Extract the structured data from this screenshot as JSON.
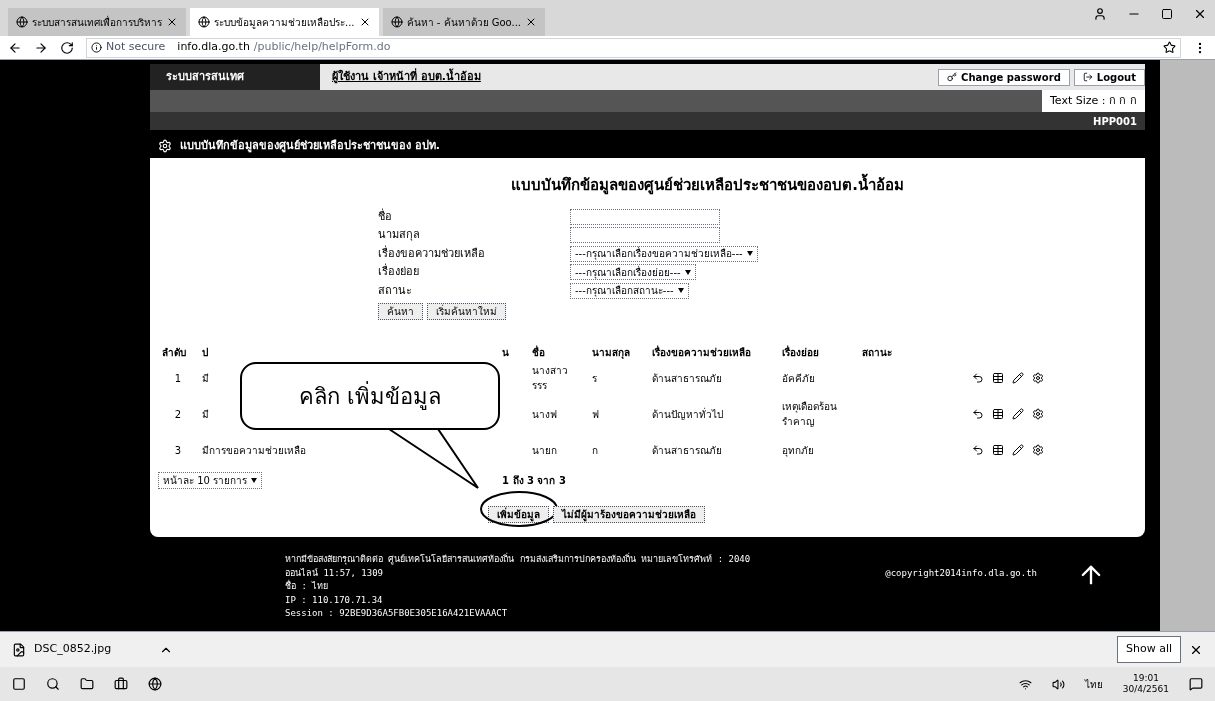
{
  "browser": {
    "tabs": [
      {
        "title": "ระบบสารสนเทศเพื่อการบริหาร",
        "selected": false
      },
      {
        "title": "ระบบข้อมูลความช่วยเหลือประ...",
        "selected": true
      },
      {
        "title": "ค้นหา - ค้นหาด้วย Goo...",
        "selected": false
      }
    ],
    "security": "Not secure",
    "url": "info.dla.go.th",
    "url_path": "/public/help/helpForm.do"
  },
  "header": {
    "app_tab": "ระบบสารสนเทศ",
    "user": "ผู้ใช้งาน เจ้าหน้าที่ อบต.น้ำอ้อม",
    "change_password": "Change password",
    "logout": "Logout",
    "text_size": "Text Size : ก ก ก",
    "code": "HPP001"
  },
  "section_title": "แบบบันทึกข้อมูลของศูนย์ช่วยเหลือประชาชนของ อปท.",
  "form": {
    "title": "แบบบันทึกข้อมูลของศูนย์ช่วยเหลือประชาชนของอบต.น้ำอ้อม",
    "fields": [
      {
        "label": "ชื่อ",
        "kind": "text"
      },
      {
        "label": "นามสกุล",
        "kind": "text"
      },
      {
        "label": "เรื่องขอความช่วยเหลือ",
        "kind": "select",
        "value": "---กรุณาเลือกเรื่องขอความช่วยเหลือ---"
      },
      {
        "label": "เรื่องย่อย",
        "kind": "select",
        "value": "---กรุณาเลือกเรื่องย่อย---"
      },
      {
        "label": "สถานะ",
        "kind": "select",
        "value": "---กรุณาเลือกสถานะ---"
      }
    ],
    "buttons": [
      "ค้นหา",
      "เริ่มค้นหาใหม่"
    ]
  },
  "table": {
    "columns": [
      "ลำดับ",
      "ป",
      "น",
      "ชื่อ",
      "นามสกุล",
      "เรื่องขอความช่วยเหลือ",
      "เรื่องย่อย",
      "สถานะ"
    ],
    "rows": [
      {
        "no": "1",
        "column_2": "มี",
        "name": "นางสาว รรร",
        "surname": "ร",
        "topic": "ด้านสาธารณภัย",
        "subtopic": "อัคคีภัย"
      },
      {
        "no": "2",
        "column_2": "มี",
        "name": "นางฟ",
        "surname": "ฟ",
        "topic": "ด้านปัญหาทั่วไป",
        "subtopic": "เหตุเดือดร้อนรำคาญ"
      },
      {
        "no": "3",
        "column_2": "มีการขอความช่วยเหลือ",
        "name": "นายก",
        "surname": "ก",
        "topic": "ด้านสาธารณภัย",
        "subtopic": "อุทกภัย"
      }
    ],
    "page_size": "หน้าละ 10 รายการ",
    "summary": "1 ถึง 3 จาก 3"
  },
  "actions": [
    "เพิ่มข้อมูล",
    "ไม่มีผู้มาร้องขอความช่วยเหลือ"
  ],
  "callout": "คลิก เพิ่มข้อมูล",
  "footer": {
    "lines": [
      "หากมีข้อสงสัยกรุณาติดต่อ ศูนย์เทคโนโลยีสารสนเทศท้องถิ่น กรมส่งเสริมการปกครองท้องถิ่น หมายเลขโทรศัพท์ : 2040",
      "ออนไลน์ 11:57, 1309",
      "ชื่อ : ไทย",
      "IP : 110.170.71.34",
      "Session : 92BE9D36A5FB0E305E16A421EVAAACT"
    ],
    "copyright": "@copyright2014info.dla.go.th"
  },
  "downloads": {
    "file": "DSC_0852.jpg",
    "show_all": "Show all"
  },
  "taskbar": {
    "time": "19:01",
    "date": "30/4/2561",
    "language": "ไทย"
  }
}
